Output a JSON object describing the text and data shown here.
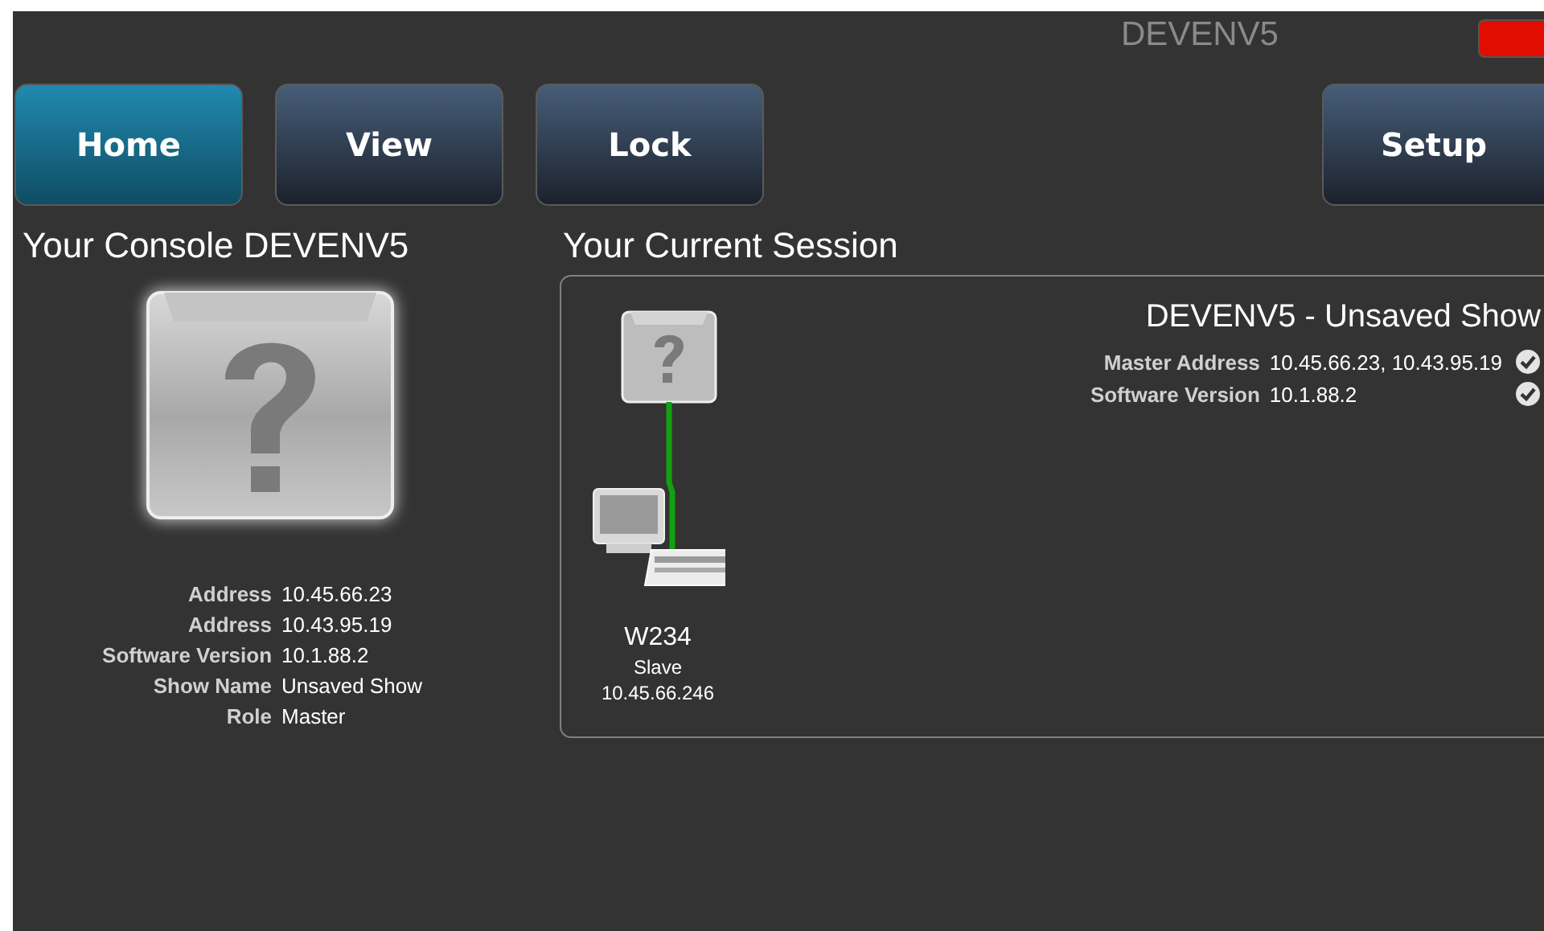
{
  "header": {
    "title": "DEVENV5"
  },
  "nav": {
    "main": [
      {
        "label": "Home",
        "selected": true
      },
      {
        "label": "View",
        "selected": false
      },
      {
        "label": "Lock",
        "selected": false
      }
    ],
    "end": [
      {
        "label": "Setup",
        "selected": false
      }
    ]
  },
  "console": {
    "heading": "Your Console DEVENV5",
    "details": [
      {
        "label": "Address",
        "value": "10.45.66.23"
      },
      {
        "label": "Address",
        "value": "10.43.95.19"
      },
      {
        "label": "Software Version",
        "value": "10.1.88.2"
      },
      {
        "label": "Show Name",
        "value": "Unsaved Show"
      },
      {
        "label": "Role",
        "value": "Master"
      }
    ]
  },
  "session": {
    "heading": "Your Current Session",
    "title": "DEVENV5 - Unsaved Show",
    "details": [
      {
        "label": "Master Address",
        "value": "10.45.66.23, 10.43.95.19",
        "verified": true
      },
      {
        "label": "Software Version",
        "value": "10.1.88.2",
        "verified": true
      }
    ],
    "device": {
      "name": "W234",
      "role": "Slave",
      "address": "10.45.66.246"
    }
  }
}
